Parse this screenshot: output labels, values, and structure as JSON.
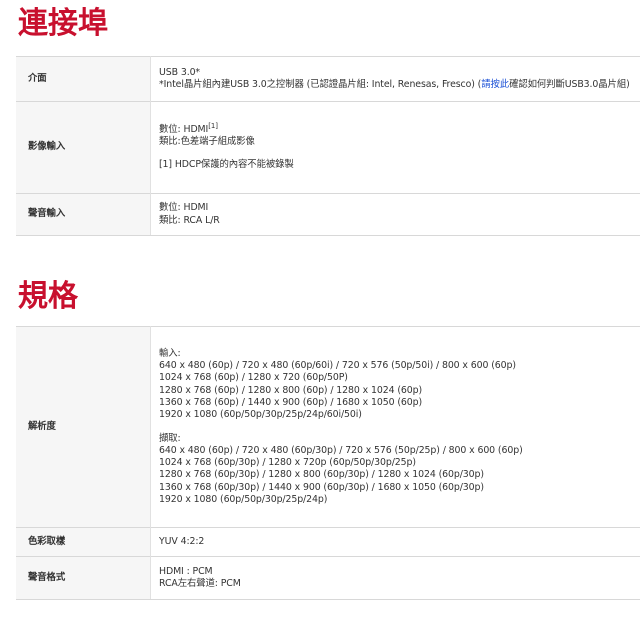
{
  "sections": {
    "ports": {
      "title": "連接埠",
      "rows": {
        "interface": {
          "label": "介面",
          "line1": "USB 3.0*",
          "line2_before": "*Intel晶片組內建USB 3.0之控制器 (已認證晶片組: Intel, Renesas, Fresco) (",
          "line2_link": "請按此",
          "line2_after": "確認如何判斷USB3.0晶片組)"
        },
        "video_input": {
          "label": "影像輸入",
          "line1": "數位: HDMI",
          "line1_sup": "[1]",
          "line2": "類比:色差端子組成影像",
          "note": "[1] HDCP保護的內容不能被錄製"
        },
        "audio_input": {
          "label": "聲音輸入",
          "line1": "數位: HDMI",
          "line2": "類比: RCA L/R"
        }
      }
    },
    "specs": {
      "title": "規格",
      "rows": {
        "resolution": {
          "label": "解析度",
          "input_header": "輸入:",
          "input_lines": [
            "640 x 480 (60p) / 720 x 480 (60p/60i) / 720 x 576 (50p/50i) / 800 x 600 (60p)",
            "1024 x 768 (60p) / 1280 x 720 (60p/50P)",
            "1280 x 768 (60p) / 1280 x 800 (60p) / 1280 x 1024 (60p)",
            "1360 x 768 (60p) / 1440 x 900 (60p) / 1680 x 1050 (60p)",
            "1920 x 1080 (60p/50p/30p/25p/24p/60i/50i)"
          ],
          "capture_header": "擷取:",
          "capture_lines": [
            "640 x 480 (60p) / 720 x 480 (60p/30p) / 720 x 576 (50p/25p) / 800 x 600 (60p)",
            "1024 x 768 (60p/30p) / 1280 x 720p (60p/50p/30p/25p)",
            "1280 x 768 (60p/30p) / 1280 x 800 (60p/30p) / 1280 x 1024 (60p/30p)",
            "1360 x 768 (60p/30p) / 1440 x 900 (60p/30p) / 1680 x 1050 (60p/30p)",
            "1920 x 1080 (60p/50p/30p/25p/24p)"
          ]
        },
        "color_sampling": {
          "label": "色彩取樣",
          "value": "YUV 4:2:2"
        },
        "audio_format": {
          "label": "聲音格式",
          "line1": "HDMI : PCM",
          "line2": "RCA左右聲道: PCM"
        }
      }
    }
  },
  "colors": {
    "title_red": "#c8102e",
    "link_blue": "#1a4fd6",
    "label_bg": "#f6f6f6",
    "border": "#d8d8d8"
  }
}
